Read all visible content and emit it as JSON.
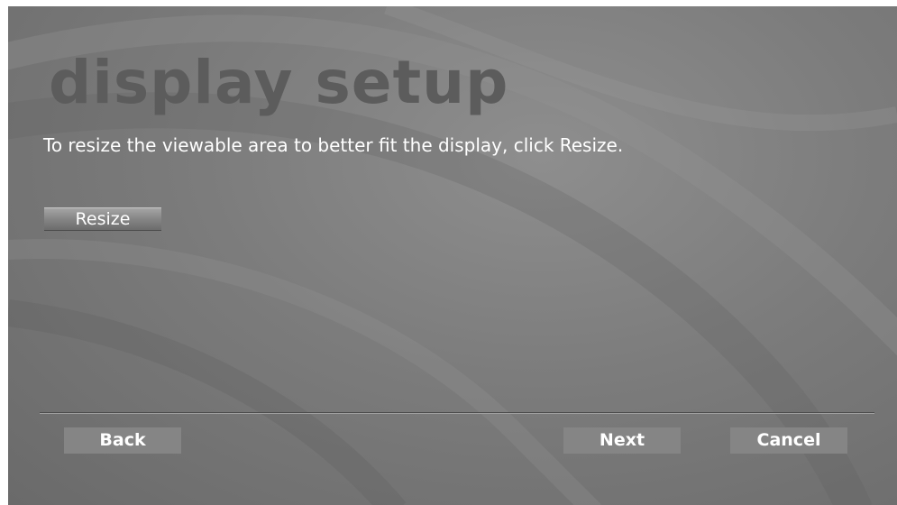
{
  "window": {
    "title": "display setup",
    "instruction": "To resize the viewable area to better fit the display, click Resize."
  },
  "actions": {
    "resize_label": "Resize"
  },
  "footer": {
    "back_label": "Back",
    "next_label": "Next",
    "cancel_label": "Cancel"
  },
  "theme": {
    "background": "#7c7c7c",
    "title_color": "#5c5c5c",
    "text_color": "#ffffff",
    "button_color": "#858585"
  }
}
